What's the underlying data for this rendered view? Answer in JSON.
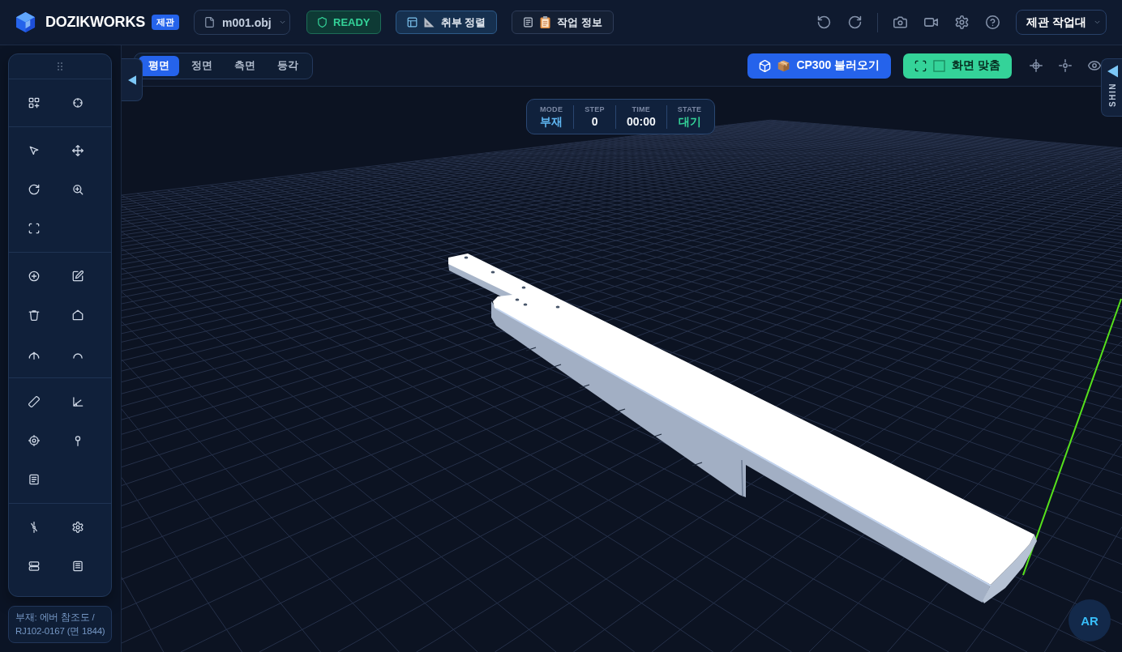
{
  "header": {
    "brand": "DOZIKWORKS",
    "brand_badge": "제관",
    "file_menu": {
      "label": "m001.obj"
    },
    "status": {
      "label": "READY",
      "kind": "ready"
    },
    "buttons": [
      {
        "label": "취부 정렬",
        "kind": "align"
      },
      {
        "label": "작업 정보",
        "kind": "info"
      }
    ],
    "workspace_menu": {
      "label": "제관 작업대"
    }
  },
  "view_tabs": [
    {
      "label": "평면",
      "selected": true
    },
    {
      "label": "정면",
      "selected": false
    },
    {
      "label": "측면",
      "selected": false
    },
    {
      "label": "등각",
      "selected": false
    }
  ],
  "viewport_actions": [
    {
      "label": "CP300 불러오기",
      "kind": "primary"
    },
    {
      "label": "화면 맞춤",
      "kind": "success"
    }
  ],
  "hud": [
    {
      "label": "MODE",
      "value": "부재",
      "color": "#60b8f4"
    },
    {
      "label": "STEP",
      "value": "0",
      "color": "#f1f5f9"
    },
    {
      "label": "TIME",
      "value": "00:00",
      "color": "#f1f5f9"
    },
    {
      "label": "STATE",
      "value": "대기",
      "color": "#34d399"
    }
  ],
  "side_panel_tab": {
    "label": "SHIN"
  },
  "part_info": "부재: 에버 참조도 / RJ102-0167 (면 1844)",
  "ar_button": {
    "label": "AR"
  }
}
